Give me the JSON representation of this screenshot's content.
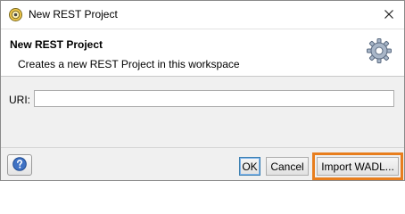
{
  "window": {
    "title": "New REST Project",
    "icon": "soapui-icon",
    "close_icon": "close-icon"
  },
  "header": {
    "title": "New REST Project",
    "description": "Creates a new REST Project in this workspace",
    "icon": "gear-icon"
  },
  "form": {
    "uri_label": "URI:",
    "uri_value": "",
    "uri_placeholder": ""
  },
  "footer": {
    "help_icon": "help-icon",
    "ok_label": "OK",
    "cancel_label": "Cancel",
    "import_label": "Import WADL..."
  },
  "colors": {
    "highlight": "#e87e1e",
    "focus_border": "#3c7fb1"
  }
}
